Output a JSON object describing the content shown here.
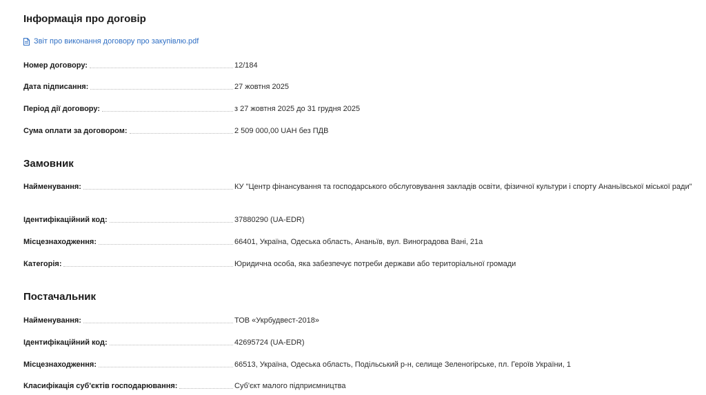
{
  "contract": {
    "title": "Інформація про договір",
    "document_link": "Звіт про виконання договору про закупівлю.pdf",
    "fields": [
      {
        "label": "Номер договору:",
        "value": "12/184"
      },
      {
        "label": "Дата підписання:",
        "value": "27 жовтня 2025"
      },
      {
        "label": "Період дії договору:",
        "value": "з 27 жовтня 2025 до 31 грудня 2025"
      },
      {
        "label": "Сума оплати за договором:",
        "value": "2 509 000,00 UAH без ПДВ"
      }
    ]
  },
  "customer": {
    "title": "Замовник",
    "fields": [
      {
        "label": "Найменування:",
        "value": "КУ \"Центр фінансування та господарського обслуговування закладів освіти, фізичної культури і спорту Ананьївської міської ради\""
      },
      {
        "label": "Ідентифікаційний код:",
        "value": "37880290 (UA-EDR)"
      },
      {
        "label": "Місцезнаходження:",
        "value": "66401, Україна, Одеська область, Ананьїв, вул. Виноградова Вані, 21а"
      },
      {
        "label": "Категорія:",
        "value": "Юридична особа, яка забезпечує потреби держави або територіальної громади"
      }
    ]
  },
  "supplier": {
    "title": "Постачальник",
    "fields": [
      {
        "label": "Найменування:",
        "value": "ТОВ «Укрбудвест-2018»"
      },
      {
        "label": "Ідентифікаційний код:",
        "value": "42695724 (UA-EDR)"
      },
      {
        "label": "Місцезнаходження:",
        "value": "66513, Україна, Одеська область, Подільський р-н, селище Зеленогірське, пл. Героїв України, 1"
      },
      {
        "label": "Класифікація суб'єктів господарювання:",
        "value": "Суб'єкт малого підприємництва"
      }
    ]
  },
  "icons": {
    "document_link_icon": "file-icon"
  },
  "colors": {
    "link": "#2f6fc4",
    "text": "#1a1a1a"
  }
}
